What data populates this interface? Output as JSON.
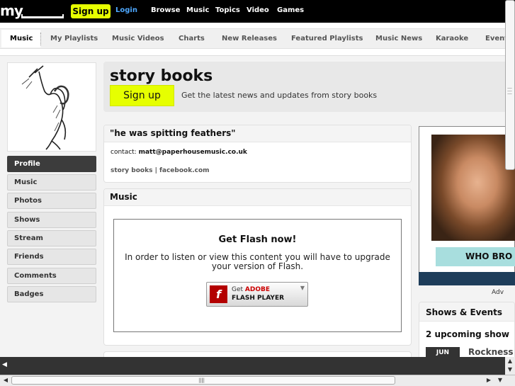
{
  "topbar": {
    "logo": "my",
    "signup_label": "Sign up",
    "login_label": "Login",
    "nav": [
      "Browse",
      "Music",
      "Topics",
      "Video",
      "Games"
    ]
  },
  "subnav": {
    "items": [
      "Music",
      "My Playlists",
      "Music Videos",
      "Charts",
      "New Releases",
      "Featured Playlists",
      "Music News",
      "Karaoke",
      "Events"
    ]
  },
  "sidebar": {
    "items": [
      "Profile",
      "Music",
      "Photos",
      "Shows",
      "Stream",
      "Friends",
      "Comments",
      "Badges"
    ]
  },
  "header": {
    "artist_name": "story books",
    "signup_label": "Sign up",
    "tagline": "Get the latest news and updates from story books"
  },
  "about": {
    "quote": "\"he was spitting feathers\"",
    "contact_prefix": "contact:",
    "contact_email": "matt@paperhousemusic.co.uk",
    "links": "story books | facebook.com"
  },
  "music": {
    "title": "Music",
    "flash_title": "Get Flash now!",
    "flash_text": "In order to listen or view this content you will have to upgrade your version of Flash.",
    "flash_get": "Get",
    "flash_adobe": "ADOBE",
    "flash_player": "FLASH PLAYER"
  },
  "ad": {
    "banner_text": "WHO BRO",
    "label": "Adv"
  },
  "shows": {
    "title": "Shows & Events",
    "upcoming": "2 upcoming show",
    "month": "JUN",
    "venue": "Rockness"
  },
  "colors": {
    "accent_yellow": "#e6ff00",
    "login_blue": "#4ea8ff",
    "active_side": "#3c3c3c"
  }
}
